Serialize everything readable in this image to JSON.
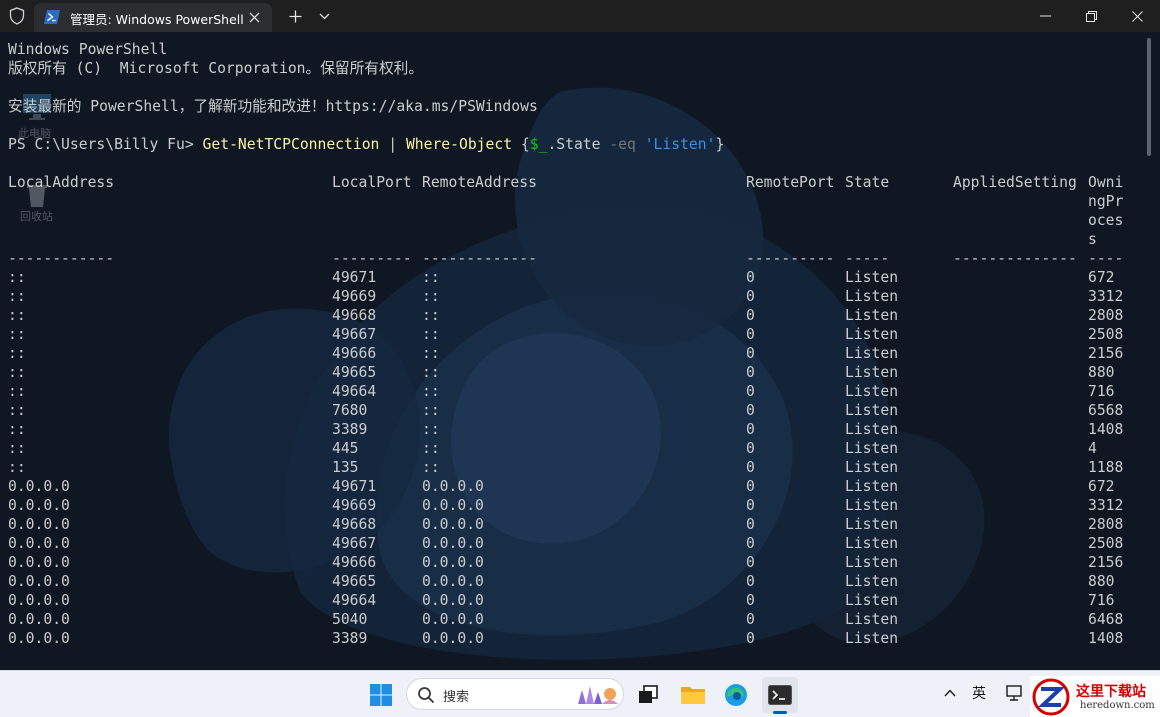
{
  "window": {
    "tab_title": "管理员: Windows PowerShell",
    "icons": {
      "shield": "shield-icon",
      "tab": "powershell-icon",
      "close": "close-icon",
      "new_tab": "plus-icon",
      "dropdown": "chevron-down-icon",
      "minimize": "minimize-icon",
      "maximize": "maximize-icon",
      "window_close": "close-icon"
    }
  },
  "terminal": {
    "header_lines": [
      "Windows PowerShell",
      "版权所有 (C)  Microsoft Corporation。保留所有权利。",
      "",
      "安装最新的 PowerShell，了解新功能和改进！https://aka.ms/PSWindows"
    ],
    "prompt": "PS C:\\Users\\Billy Fu> ",
    "command": {
      "cmdlet": "Get-NetTCPConnection",
      "pipe": " | ",
      "filter": "Where-Object",
      "brace_open": " {",
      "variable": "$_",
      "property": ".State ",
      "operator": "-eq",
      "space": " ",
      "string": "'Listen'",
      "brace_close": "}"
    },
    "columns": [
      "LocalAddress",
      "LocalPort",
      "RemoteAddress",
      "RemotePort",
      "State",
      "AppliedSetting",
      "OwningProcess"
    ],
    "owning_header_wrapped": [
      "Owni",
      "ngPr",
      "oces",
      "s"
    ],
    "dashes": [
      "------------",
      "---------",
      "-------------",
      "----------",
      "-----",
      "--------------",
      "----"
    ],
    "rows": [
      [
        "::",
        "49671",
        "::",
        "0",
        "Listen",
        "",
        "672"
      ],
      [
        "::",
        "49669",
        "::",
        "0",
        "Listen",
        "",
        "3312"
      ],
      [
        "::",
        "49668",
        "::",
        "0",
        "Listen",
        "",
        "2808"
      ],
      [
        "::",
        "49667",
        "::",
        "0",
        "Listen",
        "",
        "2508"
      ],
      [
        "::",
        "49666",
        "::",
        "0",
        "Listen",
        "",
        "2156"
      ],
      [
        "::",
        "49665",
        "::",
        "0",
        "Listen",
        "",
        "880"
      ],
      [
        "::",
        "49664",
        "::",
        "0",
        "Listen",
        "",
        "716"
      ],
      [
        "::",
        "7680",
        "::",
        "0",
        "Listen",
        "",
        "6568"
      ],
      [
        "::",
        "3389",
        "::",
        "0",
        "Listen",
        "",
        "1408"
      ],
      [
        "::",
        "445",
        "::",
        "0",
        "Listen",
        "",
        "4"
      ],
      [
        "::",
        "135",
        "::",
        "0",
        "Listen",
        "",
        "1188"
      ],
      [
        "0.0.0.0",
        "49671",
        "0.0.0.0",
        "0",
        "Listen",
        "",
        "672"
      ],
      [
        "0.0.0.0",
        "49669",
        "0.0.0.0",
        "0",
        "Listen",
        "",
        "3312"
      ],
      [
        "0.0.0.0",
        "49668",
        "0.0.0.0",
        "0",
        "Listen",
        "",
        "2808"
      ],
      [
        "0.0.0.0",
        "49667",
        "0.0.0.0",
        "0",
        "Listen",
        "",
        "2508"
      ],
      [
        "0.0.0.0",
        "49666",
        "0.0.0.0",
        "0",
        "Listen",
        "",
        "2156"
      ],
      [
        "0.0.0.0",
        "49665",
        "0.0.0.0",
        "0",
        "Listen",
        "",
        "880"
      ],
      [
        "0.0.0.0",
        "49664",
        "0.0.0.0",
        "0",
        "Listen",
        "",
        "716"
      ],
      [
        "0.0.0.0",
        "5040",
        "0.0.0.0",
        "0",
        "Listen",
        "",
        "6468"
      ],
      [
        "0.0.0.0",
        "3389",
        "0.0.0.0",
        "0",
        "Listen",
        "",
        "1408"
      ]
    ],
    "colors": {
      "text": "#cccccc",
      "cmdlet": "#f9f1a5",
      "operator": "#767676",
      "string": "#3b8eea",
      "variable": "#16c60c"
    }
  },
  "desktop": {
    "this_pc_label": "此电脑",
    "recycle_bin_label": "回收站"
  },
  "taskbar": {
    "search_placeholder": "搜索",
    "language_indicator": "英",
    "icons": {
      "start": "windows-start-icon",
      "search": "search-icon",
      "task_view": "task-view-icon",
      "explorer": "folder-icon",
      "edge": "edge-icon",
      "terminal": "terminal-icon",
      "tray": "chevron-up-icon",
      "network": "network-icon"
    }
  },
  "watermark": {
    "title": "这里下载站",
    "url": "heredown.com"
  }
}
